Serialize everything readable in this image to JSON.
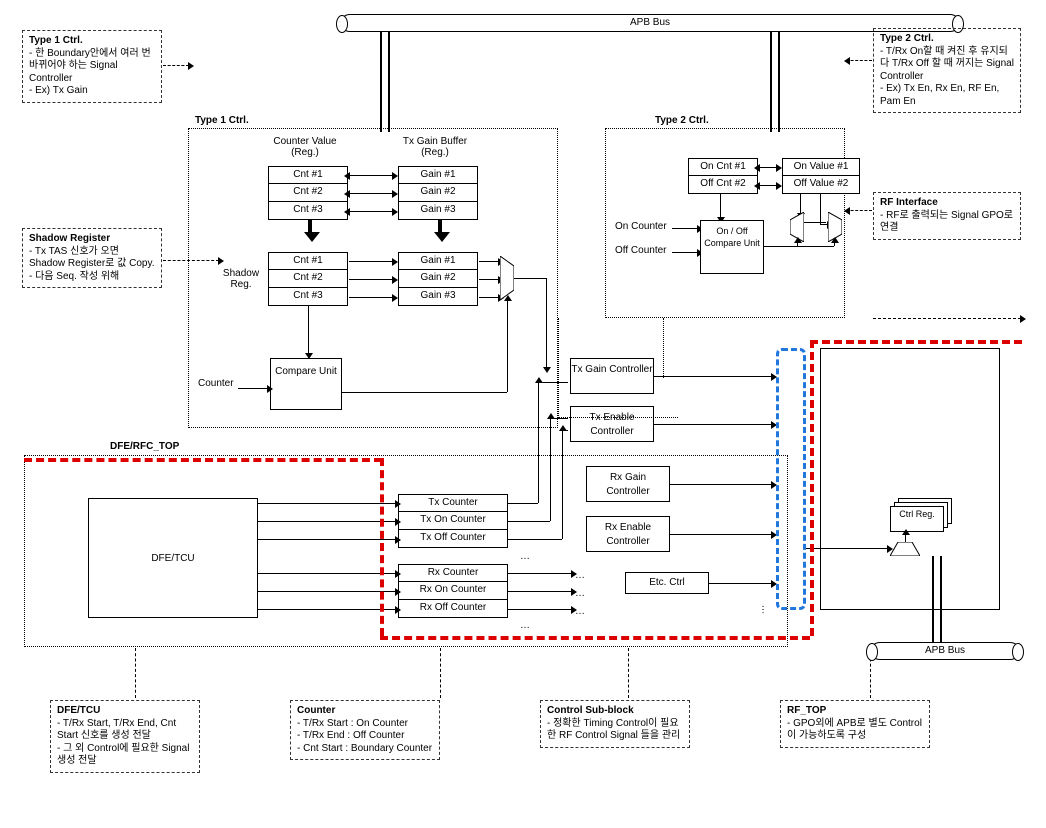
{
  "bus_top": "APB Bus",
  "bus_bottom": "APB Bus",
  "type1": {
    "title": "Type 1 Ctrl.",
    "lines": [
      "- 한 Boundary안에서 여러 번 바뀌어야 하는 Signal Controller",
      "- Ex) Tx Gain"
    ]
  },
  "shadow": {
    "title": "Shadow Register",
    "lines": [
      "- Tx TAS 신호가 오면 Shadow Register로 값 Copy.",
      "- 다음 Seq. 작성 위해"
    ]
  },
  "type2": {
    "title": "Type 2 Ctrl.",
    "lines": [
      "- T/Rx On할 때 켜진 후 유지되다 T/Rx Off 할 때 꺼지는 Signal Controller",
      "- Ex) Tx En, Rx En, RF En, Pam En"
    ]
  },
  "rfint": {
    "title": "RF Interface",
    "lines": [
      "- RF로 출력되는 Signal GPO로 연결"
    ]
  },
  "dfetcu": {
    "title": "DFE/TCU",
    "lines": [
      "- T/Rx Start, T/Rx End, Cnt Start 신호를 생성 전달",
      "- 그 외 Control에 필요한 Signal 생성 전달"
    ]
  },
  "counterbox": {
    "title": "Counter",
    "lines": [
      "- T/Rx Start  : On Counter",
      "- T/Rx End   : Off Counter",
      "- Cnt Start   : Boundary Counter"
    ]
  },
  "csb": {
    "title": "Control Sub-block",
    "lines": [
      "- 정확한 Timing Control이 필요한 RF Control Signal 들을 관리"
    ]
  },
  "rftopbox": {
    "title": "RF_TOP",
    "lines": [
      "- GPO외에 APB로 별도 Control이 가능하도록 구성"
    ]
  },
  "section": {
    "type1ctrl": "Type 1 Ctrl.",
    "type2ctrl": "Type 2 Ctrl.",
    "dferfc": "DFE/RFC_TOP",
    "rftop": "RF_TOP"
  },
  "labels": {
    "counter_value": "Counter Value (Reg.)",
    "tx_gain_buffer": "Tx Gain Buffer (Reg.)",
    "shadow_reg": "Shadow Reg.",
    "compare_unit": "Compare Unit",
    "counter_in": "Counter",
    "on_counter": "On Counter",
    "off_counter": "Off Counter",
    "onoff_compare": "On / Off Compare Unit",
    "tx_gain_ctrl": "Tx Gain Controller",
    "tx_en_ctrl": "Tx Enable Controller",
    "rx_gain_ctrl": "Rx Gain Controller",
    "rx_en_ctrl": "Rx Enable Controller",
    "etc_ctrl": "Etc. Ctrl",
    "dfetcu_block": "DFE/TCU",
    "ctrl_reg": "Ctrl Reg."
  },
  "regs": {
    "cnt": [
      "Cnt #1",
      "Cnt #2",
      "Cnt #3"
    ],
    "gain": [
      "Gain #1",
      "Gain #2",
      "Gain #3"
    ],
    "on_cnt": "On Cnt #1",
    "off_cnt": "Off Cnt #2",
    "on_val": "On Value #1",
    "off_val": "Off Value #2"
  },
  "counters": [
    "Tx Counter",
    "Tx On Counter",
    "Tx Off Counter",
    "Rx Counter",
    "Rx On Counter",
    "Rx Off Counter"
  ],
  "dots": "…"
}
